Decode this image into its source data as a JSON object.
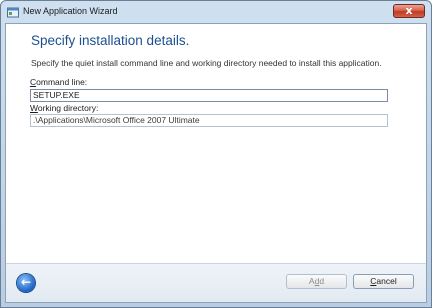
{
  "window": {
    "title": "New Application Wizard",
    "close_glyph": "x"
  },
  "page": {
    "heading": "Specify installation details.",
    "description": "Specify the quiet install command line and working directory needed to install this application."
  },
  "fields": {
    "command_label_access": "C",
    "command_label_rest": "ommand line:",
    "command_value": "SETUP.EXE",
    "working_label_access": "W",
    "working_label_rest": "orking directory:",
    "working_value": ".\\Applications\\Microsoft Office 2007 Ultimate"
  },
  "footer": {
    "back_icon": "back-arrow-icon",
    "add_pre": "A",
    "add_access": "d",
    "add_post": "d",
    "cancel_access": "C",
    "cancel_rest": "ancel"
  },
  "colors": {
    "heading": "#1c4f8f",
    "accent": "#1b62c3"
  }
}
